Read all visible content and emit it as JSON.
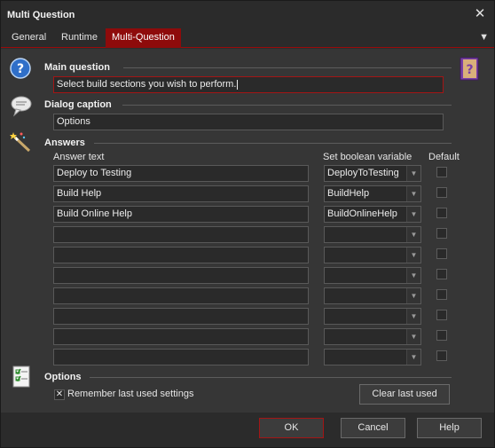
{
  "window": {
    "title": "Multi Question",
    "close_glyph": "✕"
  },
  "tabs": [
    {
      "label": "General"
    },
    {
      "label": "Runtime"
    },
    {
      "label": "Multi-Question",
      "active": true
    }
  ],
  "tab_menu_glyph": "▼",
  "main_question": {
    "heading": "Main question",
    "value": "Select build sections you wish to perform."
  },
  "dialog_caption": {
    "heading": "Dialog caption",
    "value": "Options"
  },
  "answers": {
    "heading": "Answers",
    "col_answer_text": "Answer text",
    "col_variable": "Set boolean variable",
    "col_default": "Default",
    "rows": [
      {
        "text": "Deploy to Testing",
        "variable": "DeployToTesting",
        "default": false
      },
      {
        "text": "Build Help",
        "variable": "BuildHelp",
        "default": false
      },
      {
        "text": "Build Online Help",
        "variable": "BuildOnlineHelp",
        "default": false
      },
      {
        "text": "",
        "variable": "",
        "default": false
      },
      {
        "text": "",
        "variable": "",
        "default": false
      },
      {
        "text": "",
        "variable": "",
        "default": false
      },
      {
        "text": "",
        "variable": "",
        "default": false
      },
      {
        "text": "",
        "variable": "",
        "default": false
      },
      {
        "text": "",
        "variable": "",
        "default": false
      },
      {
        "text": "",
        "variable": "",
        "default": false
      }
    ]
  },
  "options": {
    "heading": "Options",
    "remember_label": "Remember last used settings",
    "remember_checked": true,
    "clear_button": "Clear last used"
  },
  "buttons": {
    "ok": "OK",
    "cancel": "Cancel",
    "help": "Help"
  },
  "colors": {
    "accent": "#8e0b0b",
    "background": "#363636"
  },
  "icons": [
    "question-mark-icon",
    "speech-bubble-icon",
    "magic-wand-icon",
    "checklist-icon",
    "help-book-icon"
  ]
}
